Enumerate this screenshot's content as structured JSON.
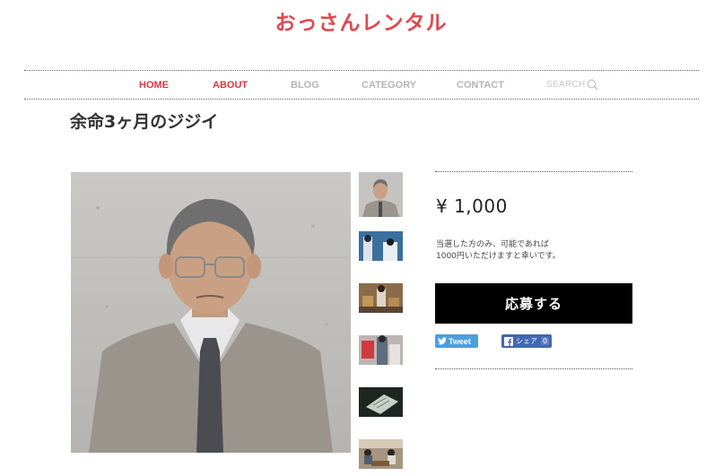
{
  "site": {
    "title": "おっさんレンタル"
  },
  "nav": {
    "items": [
      {
        "label": "HOME"
      },
      {
        "label": "ABOUT"
      },
      {
        "label": "BLOG"
      },
      {
        "label": "CATEGORY"
      },
      {
        "label": "CONTACT"
      }
    ],
    "search_placeholder": "SEARCH"
  },
  "product": {
    "title": "余命3ヶ月のジジイ",
    "price": "¥ 1,000",
    "note_line1": "当選した方のみ、可能であれば",
    "note_line2": "1000円いただけますと幸いです。",
    "apply_label": "応募する"
  },
  "social": {
    "tweet_label": "Tweet",
    "share_label": "シェア",
    "share_count": "0"
  },
  "colors": {
    "brand": "#e0484e",
    "nav_active": "#d9373d",
    "nav_inactive": "#b5b5b5",
    "button": "#000000",
    "twitter": "#4a9fe0",
    "facebook": "#4267b2"
  }
}
